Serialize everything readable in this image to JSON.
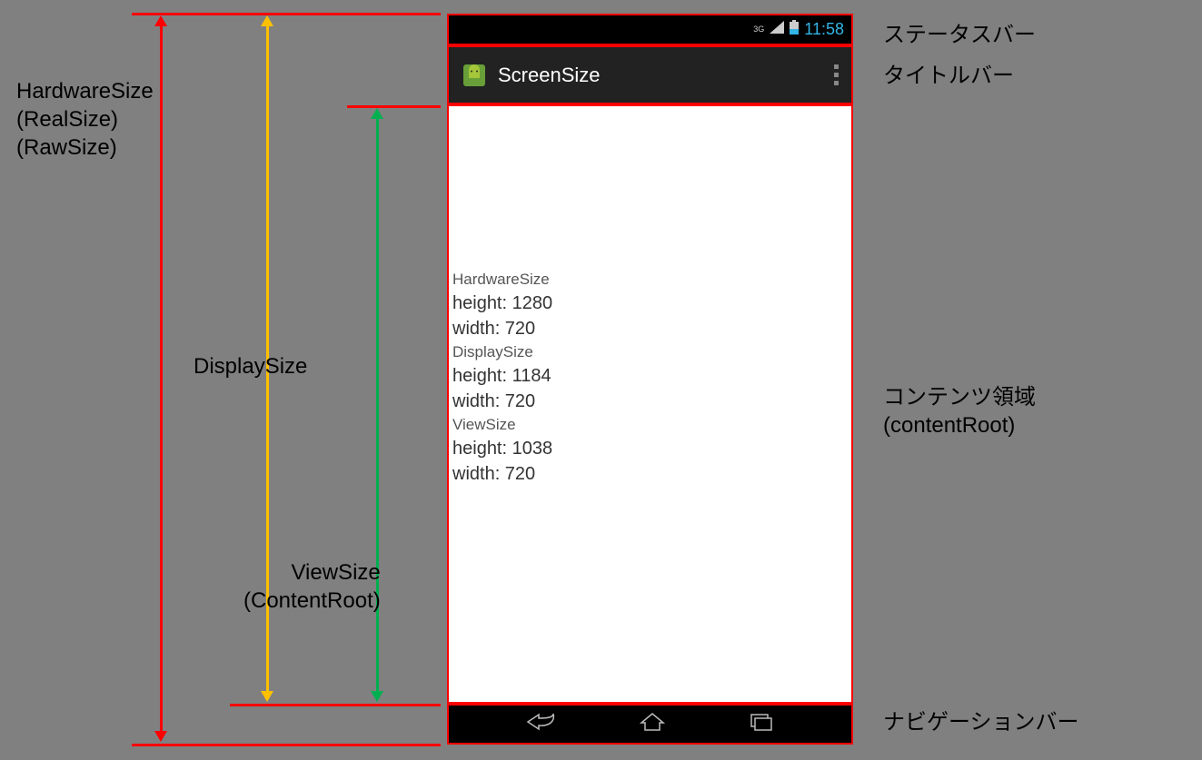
{
  "labels": {
    "hardware": "HardwareSize",
    "realsize": "(RealSize)",
    "rawsize": "(RawSize)",
    "display": "DisplaySize",
    "view": "ViewSize",
    "contentroot_paren": "(ContentRoot)",
    "status_jp": "ステータスバー",
    "title_jp": "タイトルバー",
    "content_jp": "コンテンツ領域",
    "contentroot_jp": "(contentRoot)",
    "nav_jp": "ナビゲーションバー"
  },
  "status": {
    "net": "3G",
    "time": "11:58"
  },
  "app": {
    "title": "ScreenSize"
  },
  "content": {
    "l1": "HardwareSize",
    "l2": "height: 1280",
    "l3": "width: 720",
    "l4": "DisplaySize",
    "l5": "height: 1184",
    "l6": "width: 720",
    "l7": "ViewSize",
    "l8": "height: 1038",
    "l9": "width: 720"
  },
  "colors": {
    "hardware_arrow": "#ff0000",
    "display_arrow": "#ffc000",
    "view_arrow": "#00b050"
  }
}
